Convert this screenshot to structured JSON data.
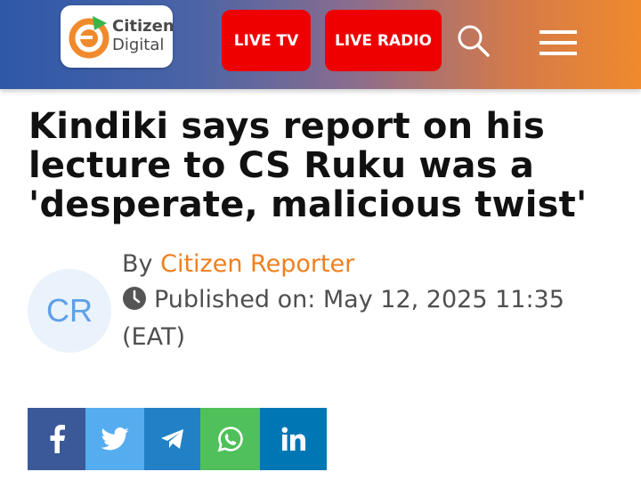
{
  "header": {
    "logo_line1": "Citizen",
    "logo_line2": "Digital",
    "live_tv_label": "LIVE TV",
    "live_radio_label": "LIVE RADIO",
    "icons": [
      "search-icon",
      "hamburger-menu-icon"
    ],
    "colors": {
      "gradient_start": "#2f58a8",
      "gradient_end": "#f08a2c",
      "button_red": "#ee0000"
    }
  },
  "article": {
    "headline": "Kindiki says report on his lecture to CS Ruku was a 'desperate, malicious twist'",
    "avatar_initials": "CR",
    "by_prefix": "By",
    "author": "Citizen Reporter",
    "published_label": "Published on: May 12, 2025 11:35 (EAT)"
  },
  "share": {
    "buttons": [
      "facebook-icon",
      "twitter-icon",
      "telegram-icon",
      "whatsapp-icon",
      "linkedin-icon"
    ],
    "colors": {
      "facebook": "#3b5998",
      "twitter": "#55acee",
      "telegram": "#2281c6",
      "whatsapp": "#4fc05a",
      "linkedin": "#0077b5"
    }
  }
}
